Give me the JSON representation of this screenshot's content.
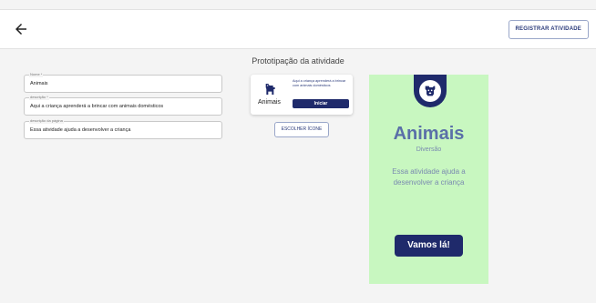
{
  "header": {
    "back_icon": "arrow-left-icon",
    "register_label": "REGISTRAR ATIVIDADE"
  },
  "main": {
    "title": "Prototipação da atividade",
    "fields": [
      {
        "label": "Nome *",
        "value": "Animais"
      },
      {
        "label": "descrição *",
        "value": "Aqui a criança aprenderá a brincar com animais domésticos"
      },
      {
        "label": "descrição da página",
        "value": "Essa atividade ajuda a desenvolver a criança"
      }
    ]
  },
  "card_preview": {
    "icon": "dog-icon",
    "name": "Animais",
    "description": "Aqui a criança aprenderá a brincar com animais domésticos",
    "start_label": "Iniciar"
  },
  "choose_icon_label": "ESCOLHER ÍCONE",
  "page_preview": {
    "icon": "dog-icon",
    "title": "Animais",
    "subtitle": "Diversão",
    "description": "Essa atividade ajuda a desenvolver a criança",
    "button_label": "Vamos lá!"
  },
  "colors": {
    "primary": "#1f2a6b",
    "preview_bg": "#c8f7c0",
    "preview_text": "#5a6fa8"
  }
}
